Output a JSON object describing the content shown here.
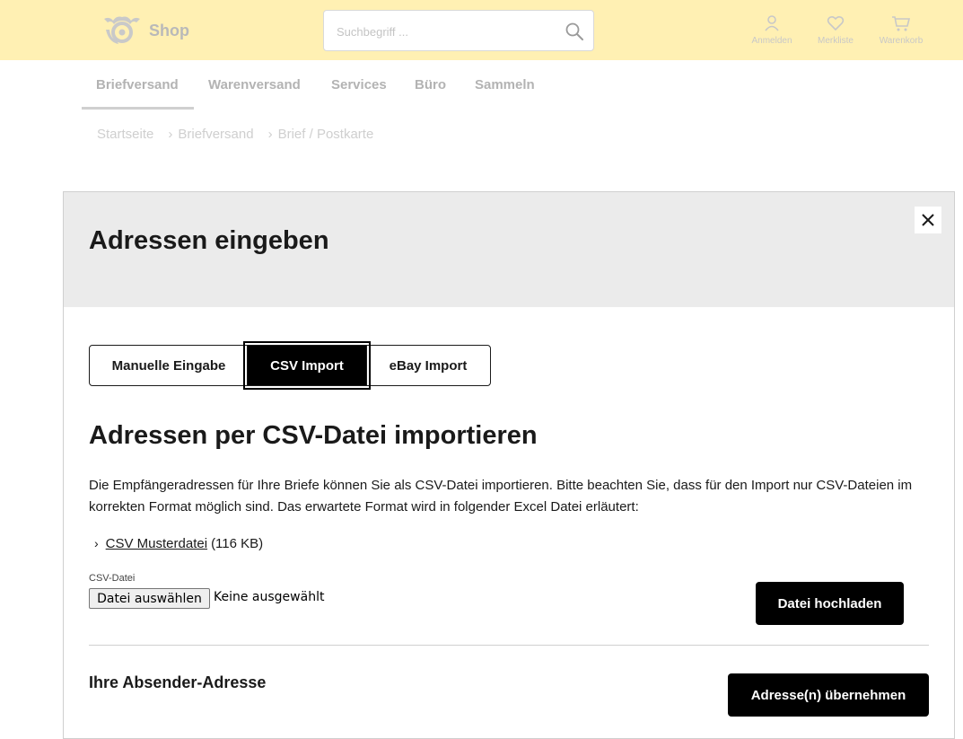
{
  "header": {
    "shop_label": "Shop",
    "search_placeholder": "Suchbegriff ...",
    "actions": {
      "login": "Anmelden",
      "wishlist": "Merkliste",
      "cart": "Warenkorb"
    },
    "bg_color": "#fff0b3"
  },
  "nav": {
    "items": [
      "Briefversand",
      "Warenversand",
      "Services",
      "Büro",
      "Sammeln"
    ]
  },
  "breadcrumb": [
    "Startseite",
    "Briefversand",
    "Brief / Postkarte"
  ],
  "modal": {
    "title": "Adressen eingeben",
    "tabs": [
      {
        "label": "Manuelle Eingabe",
        "active": false
      },
      {
        "label": "CSV Import",
        "active": true
      },
      {
        "label": "eBay Import",
        "active": false
      }
    ],
    "section_title": "Adressen per CSV-Datei importieren",
    "description": "Die Empfängeradressen für Ihre Briefe können Sie als CSV-Datei importieren. Bitte beachten Sie, dass für den Import nur CSV-Dateien im korrekten Format möglich sind. Das erwartete Format wird in folgender Excel Datei erläutert:",
    "file_link": {
      "label": "CSV Musterdatei",
      "size": "(116 KB)"
    },
    "csv_label": "CSV-Datei",
    "file_button": "Datei auswählen",
    "file_status": "Keine ausgewählt",
    "upload_button": "Datei hochladen",
    "sender_title": "Ihre Absender-Adresse",
    "accept_button": "Adresse(n) übernehmen"
  }
}
